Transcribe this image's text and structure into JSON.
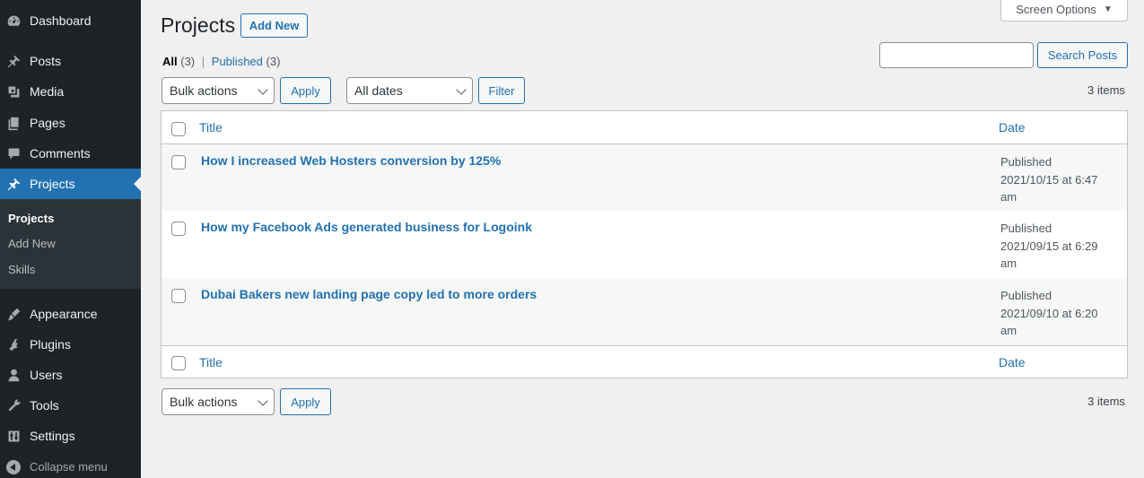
{
  "sidebar": {
    "items": [
      {
        "label": "Dashboard",
        "icon": "dashboard-icon"
      },
      {
        "label": "Posts",
        "icon": "pin-icon"
      },
      {
        "label": "Media",
        "icon": "media-icon"
      },
      {
        "label": "Pages",
        "icon": "pages-icon"
      },
      {
        "label": "Comments",
        "icon": "comment-icon"
      },
      {
        "label": "Projects",
        "icon": "pin-icon"
      },
      {
        "label": "Appearance",
        "icon": "brush-icon"
      },
      {
        "label": "Plugins",
        "icon": "plug-icon"
      },
      {
        "label": "Users",
        "icon": "user-icon"
      },
      {
        "label": "Tools",
        "icon": "wrench-icon"
      },
      {
        "label": "Settings",
        "icon": "settings-icon"
      }
    ],
    "submenu": [
      "Projects",
      "Add New",
      "Skills"
    ],
    "collapse_label": "Collapse menu"
  },
  "header": {
    "title": "Projects",
    "add_new": "Add New",
    "screen_options": "Screen Options"
  },
  "views": {
    "all_label": "All",
    "all_count": "(3)",
    "separator": "|",
    "published_label": "Published",
    "published_count": "(3)"
  },
  "search": {
    "button": "Search Posts",
    "value": ""
  },
  "toolbar": {
    "bulk_actions": "Bulk actions",
    "apply": "Apply",
    "dates": "All dates",
    "filter": "Filter",
    "count": "3 items"
  },
  "table": {
    "columns": [
      "Title",
      "Date"
    ],
    "rows": [
      {
        "title": "How I increased Web Hosters conversion by 125%",
        "status": "Published",
        "date": "2021/10/15 at 6:47",
        "ampm": "am"
      },
      {
        "title": "How my Facebook Ads generated business for Logoink",
        "status": "Published",
        "date": "2021/09/15 at 6:29",
        "ampm": "am"
      },
      {
        "title": "Dubai Bakers new landing page copy led to more orders",
        "status": "Published",
        "date": "2021/09/10 at 6:20",
        "ampm": "am"
      }
    ]
  },
  "colors": {
    "sidebar_bg": "#1d2327",
    "accent": "#2271b1",
    "page_bg": "#f0f0f1"
  }
}
